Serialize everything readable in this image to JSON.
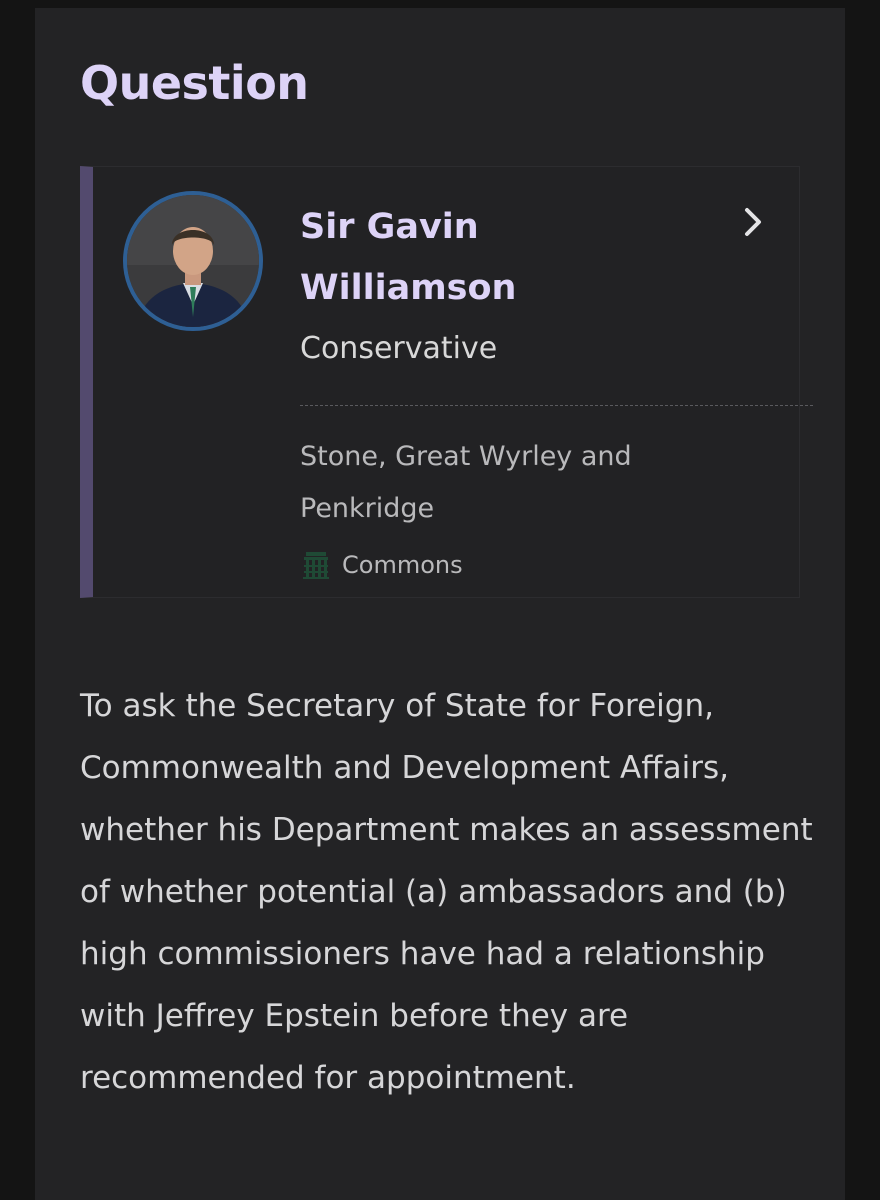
{
  "section": {
    "heading": "Question"
  },
  "member": {
    "name": "Sir Gavin Williamson",
    "party": "Conservative",
    "constituency": "Stone, Great Wyrley and Penkridge",
    "house": "Commons",
    "party_color": "#2e5f94",
    "avatar_icon": "member-portrait",
    "link_icon": "chevron-right-icon",
    "house_icon": "portcullis-icon"
  },
  "question": {
    "text": "To ask the Secretary of State for Foreign, Commonwealth and Development Affairs, whether his Department makes an assessment of whether potential (a) ambassadors and (b) high commissioners have had a relationship with Jeffrey Epstein before they are recommended for appointment."
  },
  "colors": {
    "page_background": "#141414",
    "panel_background": "#232325",
    "heading_color": "#ddd3f7",
    "card_accent": "#534a6e",
    "commons_green": "#1f4a35"
  }
}
